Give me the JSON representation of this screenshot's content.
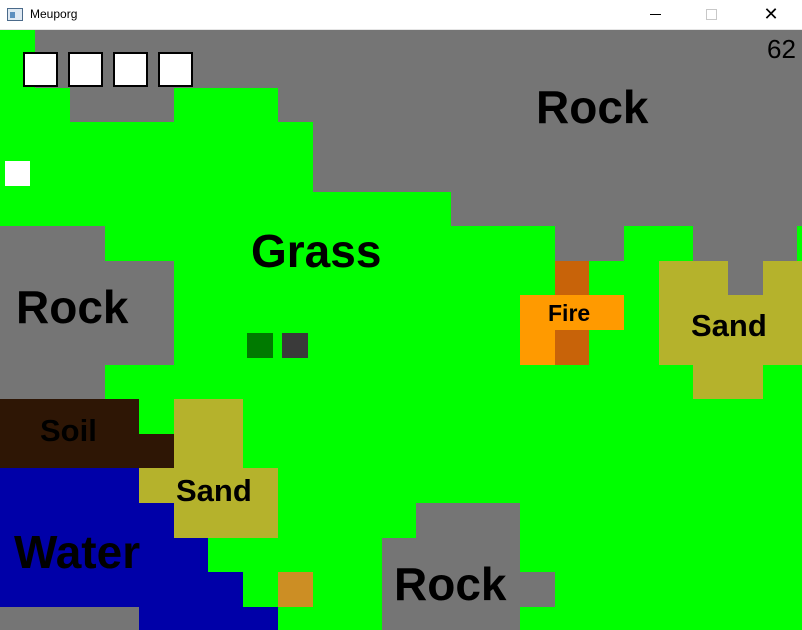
{
  "window": {
    "title": "Meuporg",
    "minimize_icon": "minimize-icon",
    "maximize_icon": "maximize-icon",
    "close_icon": "close-icon",
    "close_glyph": "✕"
  },
  "hud": {
    "fps": "62",
    "inventory_slots": 4
  },
  "map": {
    "labels": {
      "rock_top": "Rock",
      "grass": "Grass",
      "rock_left": "Rock",
      "fire": "Fire",
      "sand_right": "Sand",
      "soil": "Soil",
      "sand_left": "Sand",
      "water": "Water",
      "rock_bottom": "Rock"
    }
  },
  "colors": {
    "grass": "#00ff00",
    "rock": "#757575",
    "sand": "#b5b22c",
    "soil": "#2e1605",
    "water": "#0000a8",
    "fire": "#ff9a00",
    "fire_dark": "#c86309",
    "player": "#ffffff",
    "entity_green": "#007a00",
    "entity_gray": "#3a3a3a",
    "item": "#cc8e24"
  }
}
